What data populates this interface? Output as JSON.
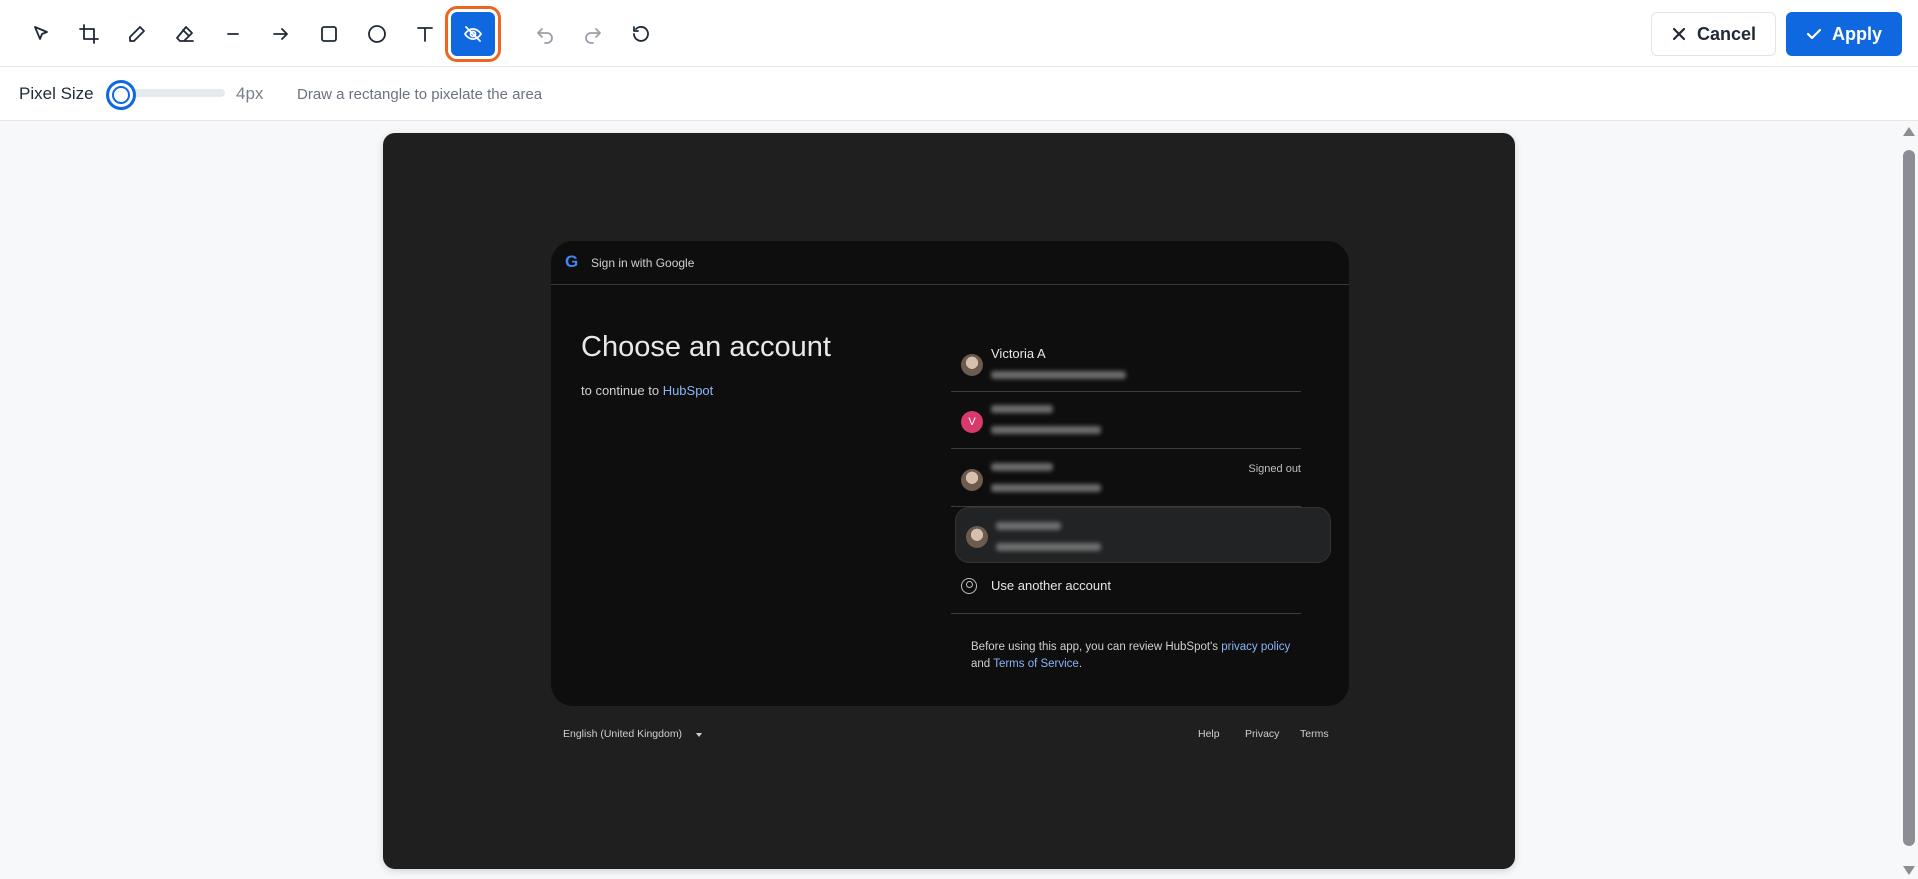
{
  "toolbar": {
    "tools": [
      {
        "id": "select",
        "icon": "select-arrow-icon"
      },
      {
        "id": "crop",
        "icon": "crop-icon"
      },
      {
        "id": "pencil",
        "icon": "pencil-icon"
      },
      {
        "id": "eraser",
        "icon": "eraser-icon"
      },
      {
        "id": "line",
        "icon": "line-icon"
      },
      {
        "id": "arrow",
        "icon": "arrow-right-icon"
      },
      {
        "id": "rectangle",
        "icon": "rectangle-icon"
      },
      {
        "id": "ellipse",
        "icon": "circle-icon"
      },
      {
        "id": "text",
        "icon": "text-icon"
      },
      {
        "id": "pixelate",
        "icon": "eye-off-icon",
        "active": true
      },
      {
        "id": "undo",
        "icon": "undo-icon"
      },
      {
        "id": "redo",
        "icon": "redo-icon"
      },
      {
        "id": "reset",
        "icon": "reset-icon"
      }
    ],
    "cancel_label": "Cancel",
    "apply_label": "Apply",
    "accent_color": "#1068e0",
    "highlight_color": "#f0641e"
  },
  "options": {
    "pixel_size_label": "Pixel Size",
    "pixel_size_value": "4px",
    "hint": "Draw a rectangle to pixelate the area"
  },
  "preview": {
    "header": "Sign in with Google",
    "title": "Choose an account",
    "continue_prefix": "to continue to",
    "continue_app": "HubSpot",
    "accounts": [
      {
        "name": "Victoria A",
        "avatar": "photo"
      },
      {
        "name": "",
        "avatar": "letter",
        "initial": "V"
      },
      {
        "name": "",
        "avatar": "photo",
        "status": "Signed out"
      },
      {
        "name": "",
        "avatar": "photo",
        "highlighted": true
      }
    ],
    "use_another": "Use another account",
    "policy_prefix": "Before using this app, you can review HubSpot's",
    "privacy_policy": "privacy policy",
    "and": "and",
    "terms_of_service": "Terms of Service",
    "policy_suffix": ".",
    "language": "English (United Kingdom)",
    "footer_links": [
      "Help",
      "Privacy",
      "Terms"
    ]
  }
}
